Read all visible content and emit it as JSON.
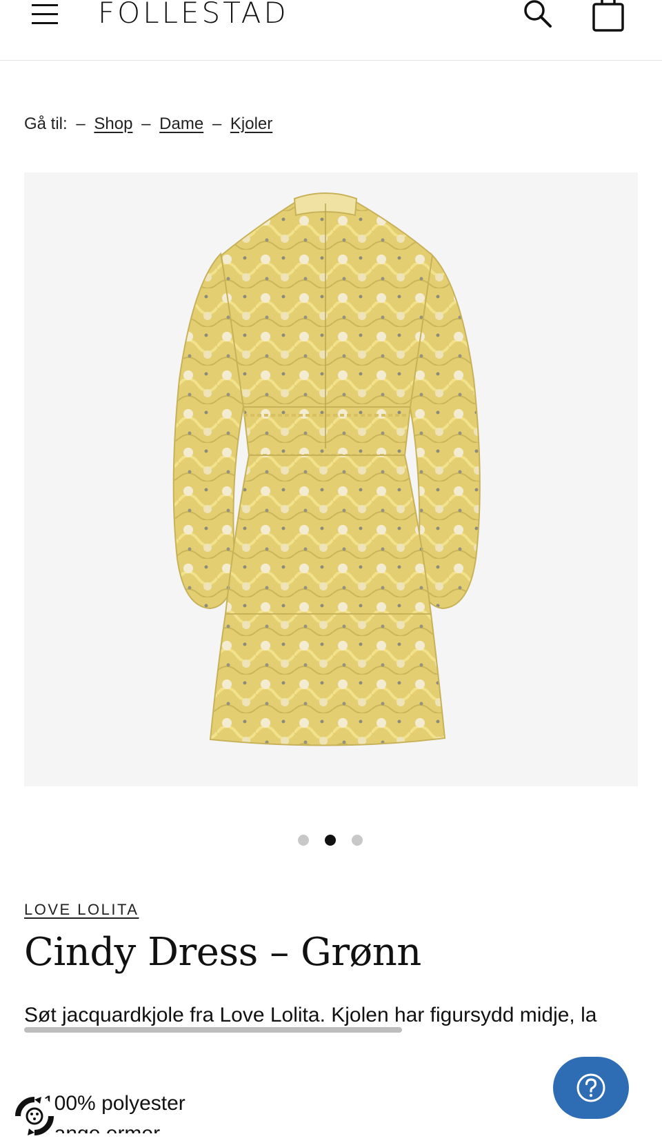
{
  "header": {
    "logo": "FOLLESTAD",
    "menu_icon": "hamburger-menu-icon",
    "search_icon": "search-icon",
    "cart_icon": "shopping-bag-icon"
  },
  "breadcrumb": {
    "prefix": "Gå til:",
    "separator": "–",
    "items": [
      "Shop",
      "Dame",
      "Kjoler"
    ]
  },
  "gallery": {
    "image": "yellow-jacquard-dress-back-view",
    "slide_count": 3,
    "active_slide": 2
  },
  "product": {
    "brand": "LOVE LOLITA",
    "title": "Cindy Dress – Grønn",
    "description": "Søt jacquardkjole fra Love Lolita. Kjolen har figursydd midje, la",
    "features": [
      "100% polyester",
      "Lange ermer"
    ]
  },
  "widgets": {
    "help_icon": "question-mark-icon",
    "eco_badge_icon": "eco-badge-icon"
  },
  "colors": {
    "help_button": "#2e6db4",
    "gallery_bg": "#f5f5f5",
    "dot_active": "#111111",
    "dot_inactive": "#c8c8c8"
  }
}
